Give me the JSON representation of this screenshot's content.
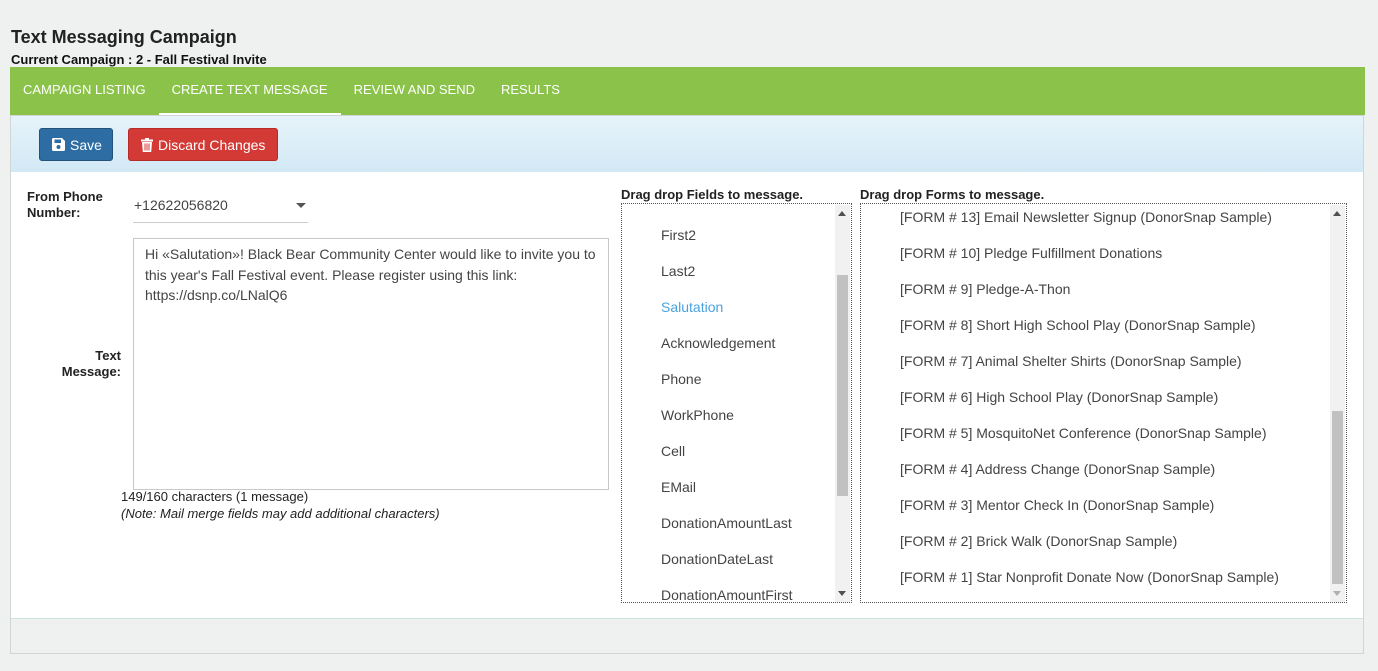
{
  "header": {
    "title": "Text Messaging Campaign",
    "current_campaign": "Current Campaign : 2 - Fall Festival Invite"
  },
  "nav": {
    "tabs": [
      {
        "label": "CAMPAIGN LISTING",
        "active": false
      },
      {
        "label": "CREATE TEXT MESSAGE",
        "active": true
      },
      {
        "label": "REVIEW AND SEND",
        "active": false
      },
      {
        "label": "RESULTS",
        "active": false
      }
    ],
    "color": "#8bc34a"
  },
  "toolbar": {
    "save_label": "Save",
    "discard_label": "Discard Changes",
    "save_color": "#2e6da4",
    "discard_color": "#d33a35"
  },
  "form": {
    "from_phone_label_1": "From Phone",
    "from_phone_label_2": "Number:",
    "from_phone_value": "+12622056820",
    "text_message_label_1": "Text",
    "text_message_label_2": "Message:",
    "message_text": "Hi «Salutation»! Black Bear Community Center would like to invite you to this year's Fall Festival event. Please register using this link: https://dsnp.co/LNalQ6",
    "char_count": "149/160 characters (1 message)",
    "note": "(Note: Mail merge fields may add additional characters)"
  },
  "fields_list": {
    "title": "Drag drop Fields to message.",
    "items": [
      "First2",
      "Last2",
      "Salutation",
      "Acknowledgement",
      "Phone",
      "WorkPhone",
      "Cell",
      "EMail",
      "DonationAmountLast",
      "DonationDateLast",
      "DonationAmountFirst"
    ],
    "highlighted": "Salutation",
    "highlight_color": "#4aa3df"
  },
  "forms_list": {
    "title": "Drag drop Forms to message.",
    "items": [
      "[FORM # 13] Email Newsletter Signup (DonorSnap Sample)",
      "[FORM # 10] Pledge Fulfillment Donations",
      "[FORM # 9] Pledge-A-Thon",
      "[FORM # 8] Short High School Play (DonorSnap Sample)",
      "[FORM # 7] Animal Shelter Shirts (DonorSnap Sample)",
      "[FORM # 6] High School Play (DonorSnap Sample)",
      "[FORM # 5] MosquitoNet Conference (DonorSnap Sample)",
      "[FORM # 4] Address Change (DonorSnap Sample)",
      "[FORM # 3] Mentor Check In (DonorSnap Sample)",
      "[FORM # 2] Brick Walk (DonorSnap Sample)",
      "[FORM # 1] Star Nonprofit Donate Now (DonorSnap Sample)"
    ]
  }
}
